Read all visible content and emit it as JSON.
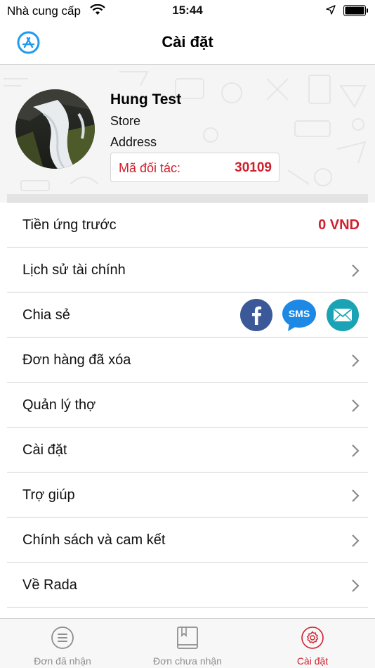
{
  "status_bar": {
    "carrier": "Nhà cung cấp",
    "time": "15:44",
    "icons": [
      "wifi-icon",
      "location-arrow-icon",
      "battery-icon"
    ]
  },
  "nav": {
    "title": "Cài đặt",
    "left_icon": "app-store-icon"
  },
  "profile": {
    "name": "Hung Test",
    "store": "Store",
    "address": "Address",
    "partner_label": "Mã đối tác:",
    "partner_code": "30109"
  },
  "list": {
    "advance": {
      "label": "Tiền ứng trước",
      "value": "0 VND"
    },
    "finance_history": {
      "label": "Lịch sử tài chính"
    },
    "share": {
      "label": "Chia sẻ",
      "icons": [
        "facebook-icon",
        "sms-icon",
        "mail-icon"
      ],
      "sms_text": "SMS"
    },
    "deleted_orders": {
      "label": "Đơn hàng đã xóa"
    },
    "manage_workers": {
      "label": "Quản lý thợ"
    },
    "settings": {
      "label": "Cài đặt"
    },
    "help": {
      "label": "Trợ giúp"
    },
    "policy": {
      "label": "Chính sách và cam kết"
    },
    "about": {
      "label": "Về Rada"
    }
  },
  "tabs": [
    {
      "label": "Đơn đã nhận",
      "icon": "list-icon",
      "active": false
    },
    {
      "label": "Đơn chưa nhận",
      "icon": "book-icon",
      "active": false
    },
    {
      "label": "Cài đặt",
      "icon": "gear-icon",
      "active": true
    }
  ],
  "colors": {
    "accent_red": "#d0202e",
    "facebook_blue": "#3b5998",
    "sms_blue": "#1e88e5",
    "mail_teal": "#1aa3b5",
    "app_store_blue": "#1e9bf0"
  }
}
